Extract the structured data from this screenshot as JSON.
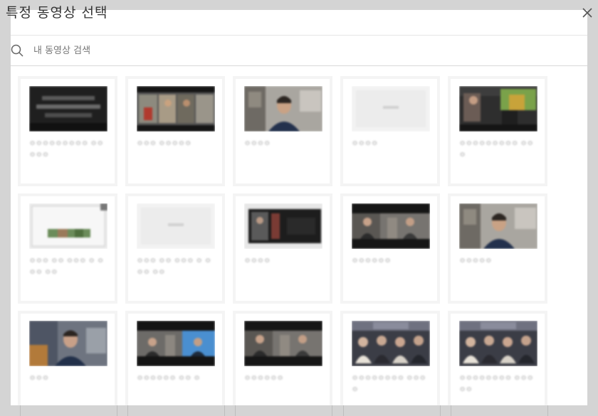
{
  "dialog": {
    "title": "특정 동영상 선택",
    "close_icon": "close-icon"
  },
  "search": {
    "placeholder": "내 동영상 검색",
    "value": "",
    "icon": "search-icon"
  },
  "videos": [
    {
      "title": "ㅇㅇㅇㅇㅇㅇㅇㅇㅇ ㅇㅇㅇㅇㅇ",
      "thumb_style": "dark-text"
    },
    {
      "title": "ㅇㅇㅇ ㅇㅇㅇㅇㅇ",
      "thumb_style": "collage"
    },
    {
      "title": "ㅇㅇㅇㅇ",
      "thumb_style": "person-room"
    },
    {
      "title": "ㅇㅇㅇㅇ",
      "thumb_style": "blank"
    },
    {
      "title": "ㅇㅇㅇㅇㅇㅇㅇㅇㅇ ㅇㅇㅇ",
      "thumb_style": "outdoor-dark"
    },
    {
      "title": "ㅇㅇㅇ ㅇㅇ ㅇㅇㅇ ㅇ ㅇㅇㅇ ㅇㅇ",
      "thumb_style": "screen-green"
    },
    {
      "title": "ㅇㅇㅇ ㅇㅇ ㅇㅇㅇ ㅇ ㅇㅇㅇ ㅇㅇ",
      "thumb_style": "blank"
    },
    {
      "title": "ㅇㅇㅇㅇ",
      "thumb_style": "dark-panel"
    },
    {
      "title": "ㅇㅇㅇㅇㅇㅇ",
      "thumb_style": "letterbox-duo"
    },
    {
      "title": "ㅇㅇㅇㅇㅇ",
      "thumb_style": "person-room"
    },
    {
      "title": "ㅇㅇㅇ",
      "thumb_style": "person-warm"
    },
    {
      "title": "ㅇㅇㅇㅇㅇㅇ ㅇㅇ ㅇ",
      "thumb_style": "letterbox-blue"
    },
    {
      "title": "ㅇㅇㅇㅇㅇㅇ",
      "thumb_style": "letterbox-duo"
    },
    {
      "title": "ㅇㅇㅇㅇㅇㅇㅇㅇ ㅇㅇㅇㅇ",
      "thumb_style": "group"
    },
    {
      "title": "ㅇㅇㅇㅇㅇㅇㅇㅇ ㅇㅇㅇㅇㅇ",
      "thumb_style": "group"
    }
  ]
}
